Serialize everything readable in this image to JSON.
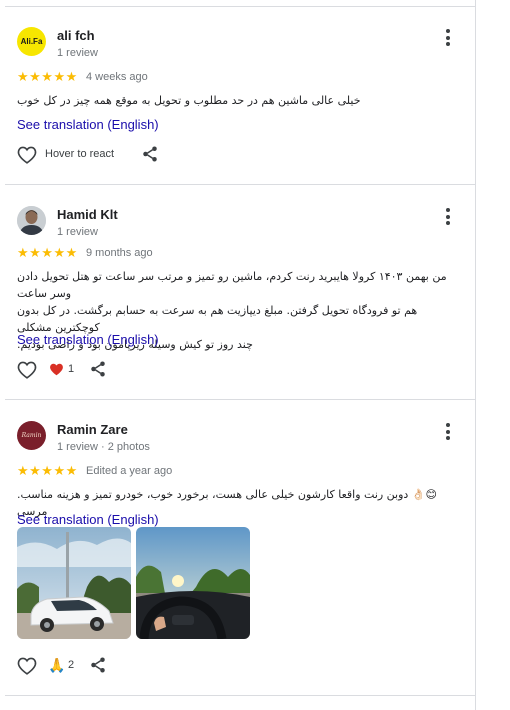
{
  "reviews": [
    {
      "avatar_text": "Ali.Fa",
      "name": "ali fch",
      "meta": "1 review",
      "stars": "★★★★★",
      "time": "4 weeks ago",
      "text_lines": [
        "خیلی عالی ماشین هم در حد مطلوب و تحویل به موقع همه چیز در کل خوب"
      ],
      "translate_label": "See translation (English)",
      "react_label": "Hover to react"
    },
    {
      "name": "Hamid Klt",
      "meta": "1 review",
      "stars": "★★★★★",
      "time": "9 months ago",
      "text_lines": [
        "من بهمن ۱۴۰۳ کرولا هایبرید رنت کردم، ماشین رو تمیز و مرتب سر ساعت تو هتل تحویل دادن وسر ساعت",
        "هم تو فرودگاه تحویل گرفتن. مبلغ دیپازیت هم به سرعت به حسابم برگشت. در کل بدون کوچکترین مشکلی",
        "چند روز تو کیش وسیله زیرپامون بود و راضی بودیم."
      ],
      "translate_label": "See translation (English)",
      "reaction_count": "1"
    },
    {
      "avatar_text": "Ramin",
      "name": "Ramin Zare",
      "meta": "1 review · 2 photos",
      "stars": "★★★★★",
      "time": "Edited a year ago",
      "text_lines": [
        "😊👌🏻 دوبن رنت واقعا کارشون خیلی عالی هست، برخورد خوب، خودرو تمیز و هزینه مناسب. مرسی"
      ],
      "translate_label": "See translation (English)",
      "reaction_emoji": "🙏",
      "reaction_count": "2"
    }
  ],
  "colors": {
    "star": "#fbbc04",
    "link": "#1a0dab",
    "heart_red": "#d93025",
    "divider": "#dadce0"
  },
  "icons": [
    "kebab-menu-icon",
    "heart-outline-icon",
    "share-icon",
    "heart-filled-icon"
  ]
}
